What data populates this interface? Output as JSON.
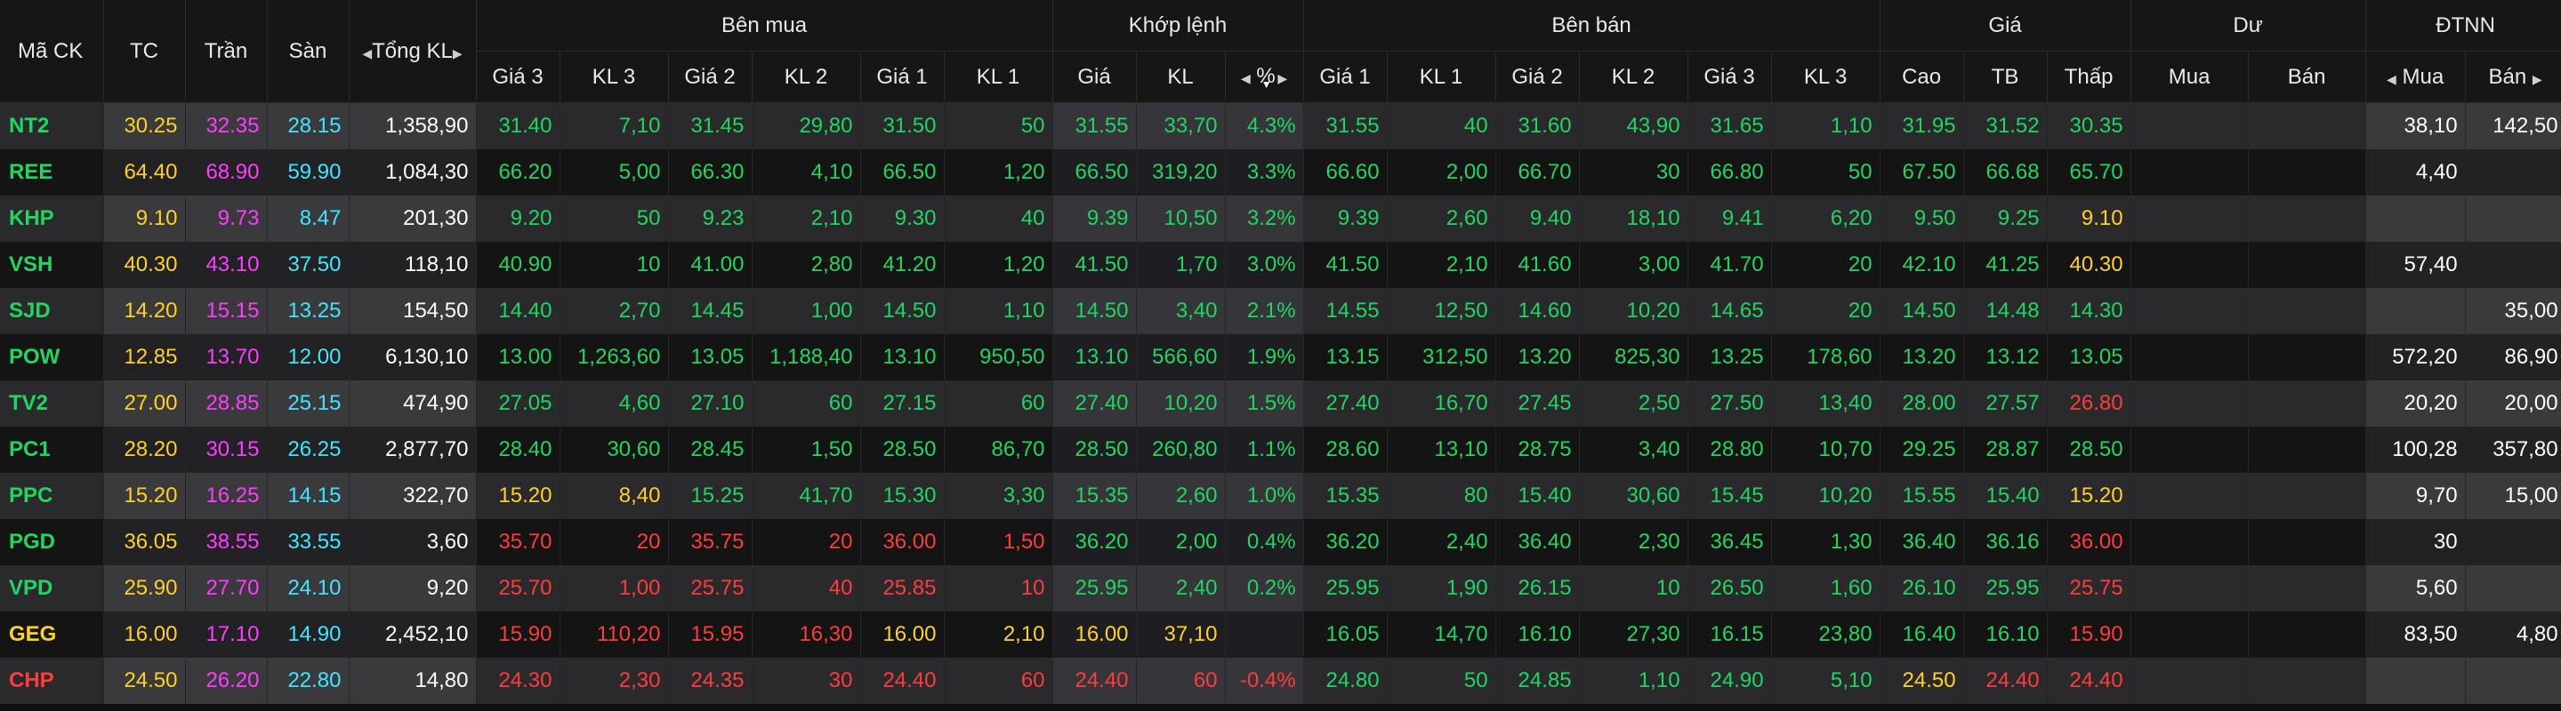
{
  "colors": {
    "up": "#1ed760",
    "down": "#ff3b3b",
    "ref": "#ffd21f",
    "ceil": "#ff3cff",
    "floor": "#3ee6ff"
  },
  "header": {
    "symbol": "Mã CK",
    "tc": "TC",
    "tran": "Trần",
    "san": "Sàn",
    "tongkl": "Tổng KL",
    "ben_mua": "Bên mua",
    "khop_lenh": "Khớp lệnh",
    "ben_ban": "Bên bán",
    "gia": "Giá",
    "du": "Dư",
    "dtnn": "ĐTNN",
    "sub": {
      "b_gia3": "Giá 3",
      "b_kl3": "KL 3",
      "b_gia2": "Giá 2",
      "b_kl2": "KL 2",
      "b_gia1": "Giá 1",
      "b_kl1": "KL 1",
      "m_gia": "Giá",
      "m_kl": "KL",
      "m_pct": "%",
      "s_gia1": "Giá 1",
      "s_kl1": "KL 1",
      "s_gia2": "Giá 2",
      "s_kl2": "KL 2",
      "s_gia3": "Giá 3",
      "s_kl3": "KL 3",
      "cao": "Cao",
      "tb": "TB",
      "thap": "Thấp",
      "du_mua": "Mua",
      "du_ban": "Bán",
      "nn_mua": "Mua",
      "nn_ban": "Bán"
    }
  },
  "rows": [
    {
      "sym": "NT2",
      "tc": "30.25",
      "tran": "32.35",
      "san": "28.15",
      "tkl": "1,358,90",
      "bg3": "31.40",
      "bk3": "7,10",
      "bg2": "31.45",
      "bk2": "29,80",
      "bg1": "31.50",
      "bk1": "50",
      "mg": "31.55",
      "mk": "33,70",
      "mp": "4.3%",
      "sg1": "31.55",
      "sk1": "40",
      "sg2": "31.60",
      "sk2": "43,90",
      "sg3": "31.65",
      "sk3": "1,10",
      "cao": "31.95",
      "tb": "31.52",
      "thap": "30.35",
      "dm": "",
      "db": "",
      "nm": "38,10",
      "nb": "142,50"
    },
    {
      "sym": "REE",
      "tc": "64.40",
      "tran": "68.90",
      "san": "59.90",
      "tkl": "1,084,30",
      "bg3": "66.20",
      "bk3": "5,00",
      "bg2": "66.30",
      "bk2": "4,10",
      "bg1": "66.50",
      "bk1": "1,20",
      "mg": "66.50",
      "mk": "319,20",
      "mp": "3.3%",
      "sg1": "66.60",
      "sk1": "2,00",
      "sg2": "66.70",
      "sk2": "30",
      "sg3": "66.80",
      "sk3": "50",
      "cao": "67.50",
      "tb": "66.68",
      "thap": "65.70",
      "dm": "",
      "db": "",
      "nm": "4,40",
      "nb": ""
    },
    {
      "sym": "KHP",
      "tc": "9.10",
      "tran": "9.73",
      "san": "8.47",
      "tkl": "201,30",
      "bg3": "9.20",
      "bk3": "50",
      "bg2": "9.23",
      "bk2": "2,10",
      "bg1": "9.30",
      "bk1": "40",
      "mg": "9.39",
      "mk": "10,50",
      "mp": "3.2%",
      "sg1": "9.39",
      "sk1": "2,60",
      "sg2": "9.40",
      "sk2": "18,10",
      "sg3": "9.41",
      "sk3": "6,20",
      "cao": "9.50",
      "tb": "9.25",
      "thap": "9.10",
      "dm": "",
      "db": "",
      "nm": "",
      "nb": ""
    },
    {
      "sym": "VSH",
      "tc": "40.30",
      "tran": "43.10",
      "san": "37.50",
      "tkl": "118,10",
      "bg3": "40.90",
      "bk3": "10",
      "bg2": "41.00",
      "bk2": "2,80",
      "bg1": "41.20",
      "bk1": "1,20",
      "mg": "41.50",
      "mk": "1,70",
      "mp": "3.0%",
      "sg1": "41.50",
      "sk1": "2,10",
      "sg2": "41.60",
      "sk2": "3,00",
      "sg3": "41.70",
      "sk3": "20",
      "cao": "42.10",
      "tb": "41.25",
      "thap": "40.30",
      "dm": "",
      "db": "",
      "nm": "57,40",
      "nb": ""
    },
    {
      "sym": "SJD",
      "tc": "14.20",
      "tran": "15.15",
      "san": "13.25",
      "tkl": "154,50",
      "bg3": "14.40",
      "bk3": "2,70",
      "bg2": "14.45",
      "bk2": "1,00",
      "bg1": "14.50",
      "bk1": "1,10",
      "mg": "14.50",
      "mk": "3,40",
      "mp": "2.1%",
      "sg1": "14.55",
      "sk1": "12,50",
      "sg2": "14.60",
      "sk2": "10,20",
      "sg3": "14.65",
      "sk3": "20",
      "cao": "14.50",
      "tb": "14.48",
      "thap": "14.30",
      "dm": "",
      "db": "",
      "nm": "",
      "nb": "35,00"
    },
    {
      "sym": "POW",
      "tc": "12.85",
      "tran": "13.70",
      "san": "12.00",
      "tkl": "6,130,10",
      "bg3": "13.00",
      "bk3": "1,263,60",
      "bg2": "13.05",
      "bk2": "1,188,40",
      "bg1": "13.10",
      "bk1": "950,50",
      "mg": "13.10",
      "mk": "566,60",
      "mp": "1.9%",
      "sg1": "13.15",
      "sk1": "312,50",
      "sg2": "13.20",
      "sk2": "825,30",
      "sg3": "13.25",
      "sk3": "178,60",
      "cao": "13.20",
      "tb": "13.12",
      "thap": "13.05",
      "dm": "",
      "db": "",
      "nm": "572,20",
      "nb": "86,90"
    },
    {
      "sym": "TV2",
      "tc": "27.00",
      "tran": "28.85",
      "san": "25.15",
      "tkl": "474,90",
      "bg3": "27.05",
      "bk3": "4,60",
      "bg2": "27.10",
      "bk2": "60",
      "bg1": "27.15",
      "bk1": "60",
      "mg": "27.40",
      "mk": "10,20",
      "mp": "1.5%",
      "sg1": "27.40",
      "sk1": "16,70",
      "sg2": "27.45",
      "sk2": "2,50",
      "sg3": "27.50",
      "sk3": "13,40",
      "cao": "28.00",
      "tb": "27.57",
      "thap": "26.80",
      "dm": "",
      "db": "",
      "nm": "20,20",
      "nb": "20,00"
    },
    {
      "sym": "PC1",
      "tc": "28.20",
      "tran": "30.15",
      "san": "26.25",
      "tkl": "2,877,70",
      "bg3": "28.40",
      "bk3": "30,60",
      "bg2": "28.45",
      "bk2": "1,50",
      "bg1": "28.50",
      "bk1": "86,70",
      "mg": "28.50",
      "mk": "260,80",
      "mp": "1.1%",
      "sg1": "28.60",
      "sk1": "13,10",
      "sg2": "28.75",
      "sk2": "3,40",
      "sg3": "28.80",
      "sk3": "10,70",
      "cao": "29.25",
      "tb": "28.87",
      "thap": "28.50",
      "dm": "",
      "db": "",
      "nm": "100,28",
      "nb": "357,80"
    },
    {
      "sym": "PPC",
      "tc": "15.20",
      "tran": "16.25",
      "san": "14.15",
      "tkl": "322,70",
      "bg3": "15.20",
      "bk3": "8,40",
      "bg2": "15.25",
      "bk2": "41,70",
      "bg1": "15.30",
      "bk1": "3,30",
      "mg": "15.35",
      "mk": "2,60",
      "mp": "1.0%",
      "sg1": "15.35",
      "sk1": "80",
      "sg2": "15.40",
      "sk2": "30,60",
      "sg3": "15.45",
      "sk3": "10,20",
      "cao": "15.55",
      "tb": "15.40",
      "thap": "15.20",
      "dm": "",
      "db": "",
      "nm": "9,70",
      "nb": "15,00"
    },
    {
      "sym": "PGD",
      "tc": "36.05",
      "tran": "38.55",
      "san": "33.55",
      "tkl": "3,60",
      "bg3": "35.70",
      "bk3": "20",
      "bg2": "35.75",
      "bk2": "20",
      "bg1": "36.00",
      "bk1": "1,50",
      "mg": "36.20",
      "mk": "2,00",
      "mp": "0.4%",
      "sg1": "36.20",
      "sk1": "2,40",
      "sg2": "36.40",
      "sk2": "2,30",
      "sg3": "36.45",
      "sk3": "1,30",
      "cao": "36.40",
      "tb": "36.16",
      "thap": "36.00",
      "dm": "",
      "db": "",
      "nm": "30",
      "nb": ""
    },
    {
      "sym": "VPD",
      "tc": "25.90",
      "tran": "27.70",
      "san": "24.10",
      "tkl": "9,20",
      "bg3": "25.70",
      "bk3": "1,00",
      "bg2": "25.75",
      "bk2": "40",
      "bg1": "25.85",
      "bk1": "10",
      "mg": "25.95",
      "mk": "2,40",
      "mp": "0.2%",
      "sg1": "25.95",
      "sk1": "1,90",
      "sg2": "26.15",
      "sk2": "10",
      "sg3": "26.50",
      "sk3": "1,60",
      "cao": "26.10",
      "tb": "25.95",
      "thap": "25.75",
      "dm": "",
      "db": "",
      "nm": "5,60",
      "nb": ""
    },
    {
      "sym": "GEG",
      "tc": "16.00",
      "tran": "17.10",
      "san": "14.90",
      "tkl": "2,452,10",
      "bg3": "15.90",
      "bk3": "110,20",
      "bg2": "15.95",
      "bk2": "16,30",
      "bg1": "16.00",
      "bk1": "2,10",
      "mg": "16.00",
      "mk": "37,10",
      "mp": "",
      "sg1": "16.05",
      "sk1": "14,70",
      "sg2": "16.10",
      "sk2": "27,30",
      "sg3": "16.15",
      "sk3": "23,80",
      "cao": "16.40",
      "tb": "16.10",
      "thap": "15.90",
      "dm": "",
      "db": "",
      "nm": "83,50",
      "nb": "4,80"
    },
    {
      "sym": "CHP",
      "tc": "24.50",
      "tran": "26.20",
      "san": "22.80",
      "tkl": "14,80",
      "bg3": "24.30",
      "bk3": "2,30",
      "bg2": "24.35",
      "bk2": "30",
      "bg1": "24.40",
      "bk1": "60",
      "mg": "24.40",
      "mk": "60",
      "mp": "-0.4%",
      "sg1": "24.80",
      "sk1": "50",
      "sg2": "24.85",
      "sk2": "1,10",
      "sg3": "24.90",
      "sk3": "5,10",
      "cao": "24.50",
      "tb": "24.40",
      "thap": "24.40",
      "dm": "",
      "db": "",
      "nm": "",
      "nb": ""
    }
  ]
}
